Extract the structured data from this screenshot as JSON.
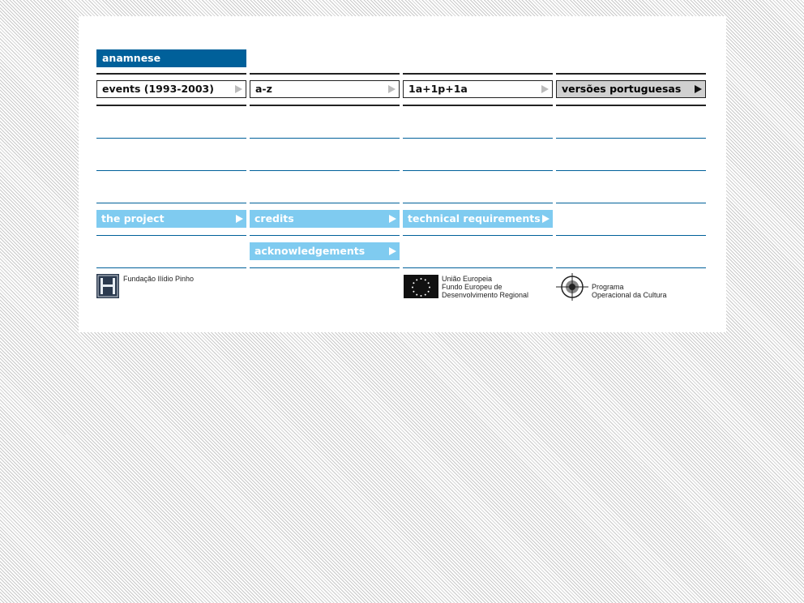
{
  "header": {
    "title": "anamnese"
  },
  "nav": {
    "events": "events (1993-2003)",
    "az": "a-z",
    "formula": "1a+1p+1a",
    "portuguese": "versões portuguesas"
  },
  "links": {
    "project": "the project",
    "credits": "credits",
    "technical": "technical requirements",
    "acknowledgements": "acknowledgements"
  },
  "logos": {
    "fundacao": "Fundação Ilídio Pinho",
    "eu_line1": "União Europeia",
    "eu_line2": "Fundo Europeu de",
    "eu_line3": "Desenvolvimento Regional",
    "poc_line1": "Programa",
    "poc_line2": "Operacional da Cultura"
  },
  "colors": {
    "brand_blue": "#00609a",
    "light_blue": "#7fcbf0",
    "selected_grey": "#d0d0d0"
  }
}
